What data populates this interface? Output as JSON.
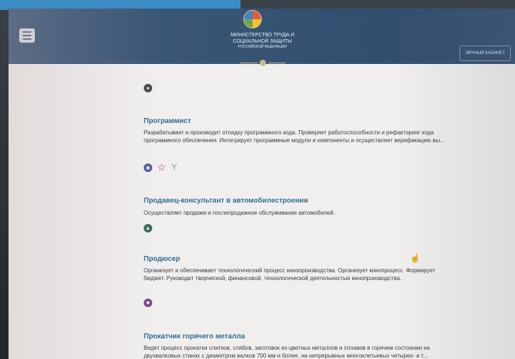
{
  "header": {
    "ministry_line1": "МИНИСТЕРСТВО ТРУДА И",
    "ministry_line2": "СОЦИАЛЬНОЙ ЗАЩИТЫ",
    "ministry_line3": "РОССИЙСКОЙ ФЕДЕРАЦИИ",
    "cabinet_label": "ЛИЧНЫЙ КАБИНЕТ"
  },
  "icons": {
    "menu": "hamburger-menu-icon",
    "lock": "lock-icon",
    "programmer_1": "globe-icon",
    "programmer_2": "star-icon",
    "programmer_3": "cocktail-glass-icon",
    "sales": "car-icon",
    "producer": "bank-icon"
  },
  "colors": {
    "header_bg": "#375374",
    "title_color": "#2f6e95",
    "page_bg": "#f1efee"
  },
  "professions": [
    {
      "title": "Программист",
      "desc": "Разрабатывает и производит отладку программного кода. Проверяет работоспособности и рефакторинг кода программного обеспечения. Интегрирует программные модули и компоненты и осуществляет верификацию вы..."
    },
    {
      "title": "Продавец-консультант в автомобилестроении",
      "desc": "Осуществляет продажи и послепродажное обслуживание автомобилей."
    },
    {
      "title": "Продюсер",
      "desc": "Организует и обеспечивает технологический процесс кинопроизводства. Организует кинопроцесс. Формирует бюджет. Руководит творческой, финансовой, технологической деятельностью кинопроизводства."
    },
    {
      "title": "Прокатчик горячего металла",
      "desc": "Ведет процесс прокатки слитков, слябов, заготовок из цветных металлов и сплавов в горячем состоянии на двухвалковых станах с диаметром валков 700 мм и более, на непрерывных многоклетьевых четырех- и т..."
    }
  ]
}
